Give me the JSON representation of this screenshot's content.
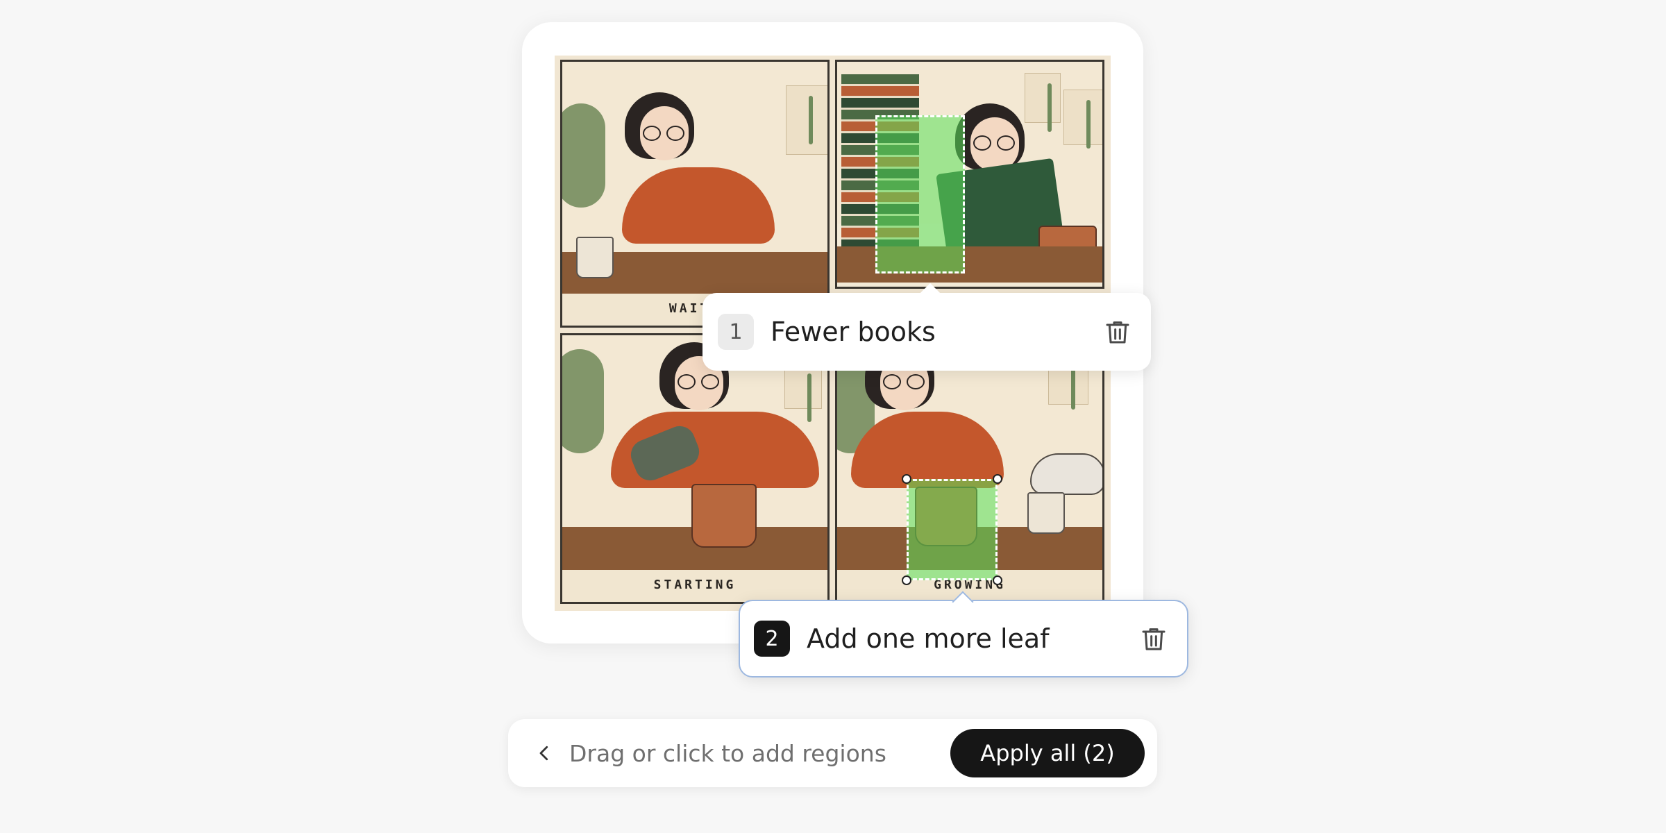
{
  "artwork": {
    "panels": [
      {
        "label": "WAITI"
      },
      {
        "label": ""
      },
      {
        "label": "STARTING"
      },
      {
        "label": "GROWING"
      }
    ]
  },
  "regions": [
    {
      "number": "1",
      "instruction": "Fewer books",
      "selected": false
    },
    {
      "number": "2",
      "instruction": "Add one more leaf",
      "selected": true
    }
  ],
  "toolbar": {
    "hint": "Drag or click to add regions",
    "apply_label": "Apply all (2)"
  },
  "colors": {
    "background": "#f7f7f7",
    "region_fill": "#5ae05a",
    "primary_button": "#161616",
    "active_popover_border": "#9db8e0"
  },
  "icons": {
    "back": "chevron-left-icon",
    "delete": "trash-icon"
  }
}
